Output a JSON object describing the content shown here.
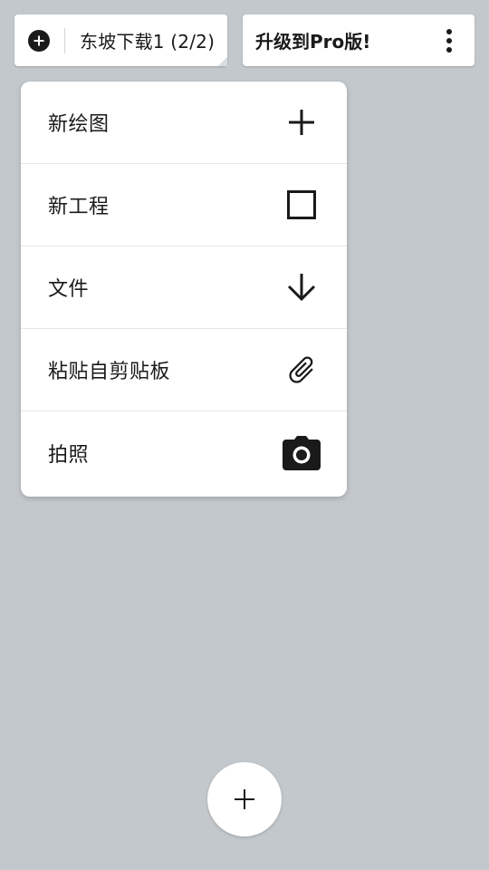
{
  "header": {
    "document_title": "东坡下载1 (2/2)",
    "upgrade_label": "升级到Pro版!"
  },
  "menu": {
    "items": [
      {
        "label": "新绘图",
        "icon": "plus-icon"
      },
      {
        "label": "新工程",
        "icon": "square-icon"
      },
      {
        "label": "文件",
        "icon": "arrow-down-icon"
      },
      {
        "label": "粘贴自剪贴板",
        "icon": "paperclip-icon"
      },
      {
        "label": "拍照",
        "icon": "camera-icon"
      }
    ]
  },
  "fab": {
    "icon": "plus-icon"
  },
  "colors": {
    "background": "#c3c8cc",
    "surface": "#ffffff",
    "icon": "#1a1a1a"
  }
}
